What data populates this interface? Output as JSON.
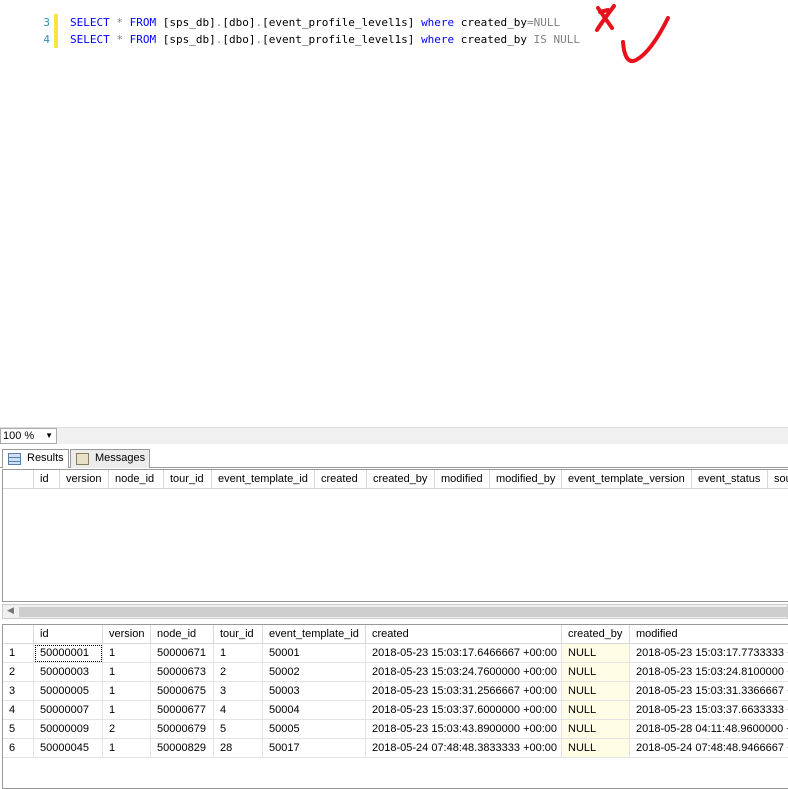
{
  "editor": {
    "lines": [
      {
        "number": "3",
        "parts": [
          [
            "kw",
            "SELECT"
          ],
          [
            "op",
            " * "
          ],
          [
            "kw",
            "FROM"
          ],
          [
            "t",
            " [sps_db]"
          ],
          [
            "op",
            "."
          ],
          [
            "t",
            "[dbo]"
          ],
          [
            "op",
            "."
          ],
          [
            "t",
            "[event_profile_level1s] "
          ],
          [
            "kw",
            "where"
          ],
          [
            "t",
            " created_by"
          ],
          [
            "op",
            "=NULL"
          ]
        ]
      },
      {
        "number": "4",
        "parts": [
          [
            "kw",
            "SELECT"
          ],
          [
            "op",
            " * "
          ],
          [
            "kw",
            "FROM"
          ],
          [
            "t",
            " [sps_db]"
          ],
          [
            "op",
            "."
          ],
          [
            "t",
            "[dbo]"
          ],
          [
            "op",
            "."
          ],
          [
            "t",
            "[event_profile_level1s] "
          ],
          [
            "kw",
            "where"
          ],
          [
            "t",
            " created_by "
          ],
          [
            "op",
            "IS NULL"
          ]
        ]
      }
    ],
    "annotations": {
      "wrong": "x-mark",
      "right": "check-mark",
      "color": "#e8101a"
    }
  },
  "zoom": {
    "value": "100 %"
  },
  "tabs": [
    {
      "label": "Results",
      "icon": "grid-icon"
    },
    {
      "label": "Messages",
      "icon": "messages-icon"
    }
  ],
  "grid1": {
    "columns": [
      "id",
      "version",
      "node_id",
      "tour_id",
      "event_template_id",
      "created",
      "created_by",
      "modified",
      "modified_by",
      "event_template_version",
      "event_status",
      "sou"
    ]
  },
  "grid2": {
    "columns": [
      "id",
      "version",
      "node_id",
      "tour_id",
      "event_template_id",
      "created",
      "created_by",
      "modified"
    ],
    "rows": [
      [
        "1",
        "50000001",
        "1",
        "50000671",
        "1",
        "50001",
        "2018-05-23 15:03:17.6466667 +00:00",
        "NULL",
        "2018-05-23 15:03:17.7733333 +"
      ],
      [
        "2",
        "50000003",
        "1",
        "50000673",
        "2",
        "50002",
        "2018-05-23 15:03:24.7600000 +00:00",
        "NULL",
        "2018-05-23 15:03:24.8100000 +"
      ],
      [
        "3",
        "50000005",
        "1",
        "50000675",
        "3",
        "50003",
        "2018-05-23 15:03:31.2566667 +00:00",
        "NULL",
        "2018-05-23 15:03:31.3366667 +"
      ],
      [
        "4",
        "50000007",
        "1",
        "50000677",
        "4",
        "50004",
        "2018-05-23 15:03:37.6000000 +00:00",
        "NULL",
        "2018-05-23 15:03:37.6633333 +"
      ],
      [
        "5",
        "50000009",
        "2",
        "50000679",
        "5",
        "50005",
        "2018-05-23 15:03:43.8900000 +00:00",
        "NULL",
        "2018-05-28 04:11:48.9600000 +"
      ],
      [
        "6",
        "50000045",
        "1",
        "50000829",
        "28",
        "50017",
        "2018-05-24 07:48:48.3833333 +00:00",
        "NULL",
        "2018-05-24 07:48:48.9466667 +"
      ]
    ]
  }
}
